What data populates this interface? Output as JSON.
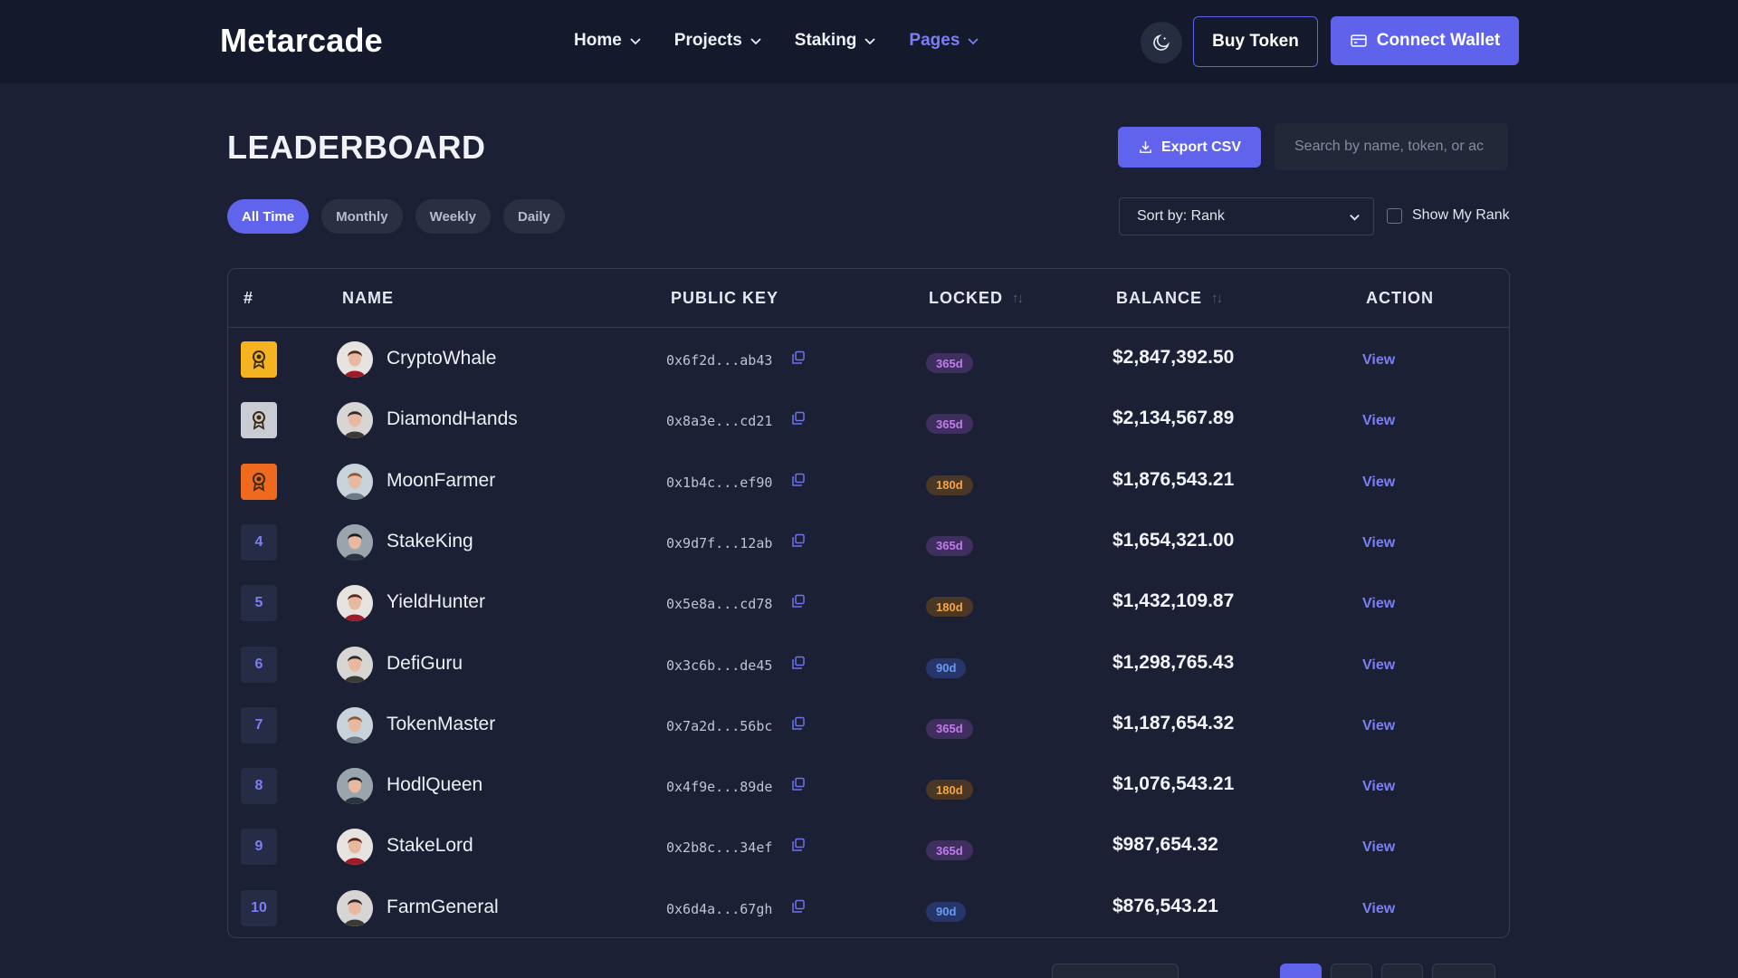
{
  "nav": {
    "logo": "Metarcade",
    "items": [
      {
        "label": "Home",
        "active": false
      },
      {
        "label": "Projects",
        "active": false
      },
      {
        "label": "Staking",
        "active": false
      },
      {
        "label": "Pages",
        "active": true
      }
    ],
    "theme_icon": "moon-icon",
    "buy_label": "Buy Token",
    "wallet_label": "Connect Wallet",
    "wallet_icon": "wallet-icon"
  },
  "header": {
    "title": "LEADERBOARD",
    "export_label": "Export CSV",
    "export_icon": "download-icon",
    "search_placeholder": "Search by name, token, or ac"
  },
  "filters": {
    "tabs": [
      "All Time",
      "Monthly",
      "Weekly",
      "Daily"
    ],
    "active_tab": "All Time",
    "sort_label": "Sort by: Rank",
    "show_my_rank_label": "Show My Rank",
    "show_my_rank_checked": false
  },
  "table": {
    "columns": {
      "rank": "#",
      "name": "NAME",
      "public_key": "PUBLIC KEY",
      "locked": "LOCKED",
      "balance": "BALANCE",
      "action": "ACTION"
    },
    "rows": [
      {
        "rank": "1",
        "medal": "gold",
        "name": "CryptoWhale",
        "key": "0x6f2d...ab43",
        "locked": "365d",
        "balance": "$2,847,392.50",
        "action": "View"
      },
      {
        "rank": "2",
        "medal": "silver",
        "name": "DiamondHands",
        "key": "0x8a3e...cd21",
        "locked": "365d",
        "balance": "$2,134,567.89",
        "action": "View"
      },
      {
        "rank": "3",
        "medal": "bronze",
        "name": "MoonFarmer",
        "key": "0x1b4c...ef90",
        "locked": "180d",
        "balance": "$1,876,543.21",
        "action": "View"
      },
      {
        "rank": "4",
        "medal": "",
        "name": "StakeKing",
        "key": "0x9d7f...12ab",
        "locked": "365d",
        "balance": "$1,654,321.00",
        "action": "View"
      },
      {
        "rank": "5",
        "medal": "",
        "name": "YieldHunter",
        "key": "0x5e8a...cd78",
        "locked": "180d",
        "balance": "$1,432,109.87",
        "action": "View"
      },
      {
        "rank": "6",
        "medal": "",
        "name": "DefiGuru",
        "key": "0x3c6b...de45",
        "locked": "90d",
        "balance": "$1,298,765.43",
        "action": "View"
      },
      {
        "rank": "7",
        "medal": "",
        "name": "TokenMaster",
        "key": "0x7a2d...56bc",
        "locked": "365d",
        "balance": "$1,187,654.32",
        "action": "View"
      },
      {
        "rank": "8",
        "medal": "",
        "name": "HodlQueen",
        "key": "0x4f9e...89de",
        "locked": "180d",
        "balance": "$1,076,543.21",
        "action": "View"
      },
      {
        "rank": "9",
        "medal": "",
        "name": "StakeLord",
        "key": "0x2b8c...34ef",
        "locked": "365d",
        "balance": "$987,654.32",
        "action": "View"
      },
      {
        "rank": "10",
        "medal": "",
        "name": "FarmGeneral",
        "key": "0x6d4a...67gh",
        "locked": "90d",
        "balance": "$876,543.21",
        "action": "View"
      }
    ]
  },
  "colors": {
    "accent": "#6064ec",
    "gold": "#f5b321",
    "silver": "#c9ccd4",
    "bronze": "#ef6a1e",
    "lock_365": "#c37bf0",
    "lock_180": "#f4a443",
    "lock_90": "#6c9af2"
  }
}
